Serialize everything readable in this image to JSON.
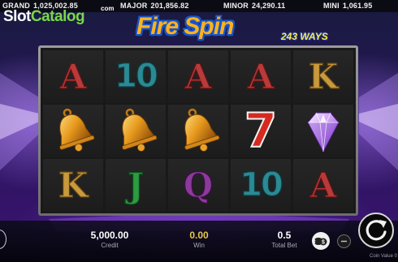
{
  "jackpots": [
    {
      "label": "GRAND",
      "value": "1,025,002.85"
    },
    {
      "label": "MAJOR",
      "value": "201,856.82"
    },
    {
      "label": "MINOR",
      "value": "24,290.11"
    },
    {
      "label": "MINI",
      "value": "1,061.95"
    }
  ],
  "watermark": {
    "part1": "Slot",
    "part2": "Catalog",
    "suffix": "com"
  },
  "game": {
    "title": "Fire Spin",
    "ways": "243 WAYS"
  },
  "reels": {
    "rows": [
      [
        "A",
        "10",
        "A",
        "A",
        "K"
      ],
      [
        "bell",
        "bell",
        "bell",
        "7",
        "diamond"
      ],
      [
        "K",
        "J",
        "Q",
        "10",
        "A"
      ]
    ]
  },
  "status": {
    "credit_value": "5,000.00",
    "credit_label": "Credit",
    "win_value": "0.00",
    "win_label": "Win",
    "bet_value": "0.5",
    "bet_label": "Total Bet",
    "coin_value_label": "Coin Value 0"
  },
  "icons": {
    "spin": "spin-arrow-icon",
    "coins": "coin-stack-icon",
    "minus": "minus-icon",
    "menu": "menu-icon"
  },
  "colors": {
    "accent_gold": "#ffb21c",
    "title_outline": "#1a55c8",
    "logo_green": "#7bd64b",
    "background_purple": "#2d1560"
  }
}
